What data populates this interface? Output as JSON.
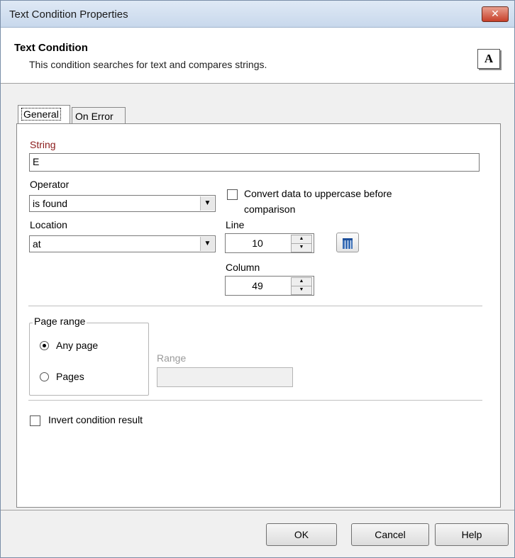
{
  "window": {
    "title": "Text Condition Properties",
    "close_label": "✕"
  },
  "header": {
    "title": "Text Condition",
    "subtitle": "This condition searches for text and compares strings.",
    "icon_letter": "A"
  },
  "tabs": {
    "general": "General",
    "on_error": "On Error"
  },
  "form": {
    "string_label": "String",
    "string_value": "E",
    "operator_label": "Operator",
    "operator_value": "is found",
    "uppercase_label_line1": "Convert data to uppercase before",
    "uppercase_label_line2": "comparison",
    "location_label": "Location",
    "location_value": "at",
    "line_label": "Line",
    "line_value": "10",
    "column_label": "Column",
    "column_value": "49",
    "page_range_label": "Page range",
    "any_page_label": "Any page",
    "pages_label": "Pages",
    "range_label": "Range",
    "range_value": "",
    "invert_label": "Invert condition result"
  },
  "buttons": {
    "ok": "OK",
    "cancel": "Cancel",
    "help": "Help"
  },
  "colors": {
    "string_label_color": "#8b1a1a",
    "close_button": "#c7402a"
  }
}
